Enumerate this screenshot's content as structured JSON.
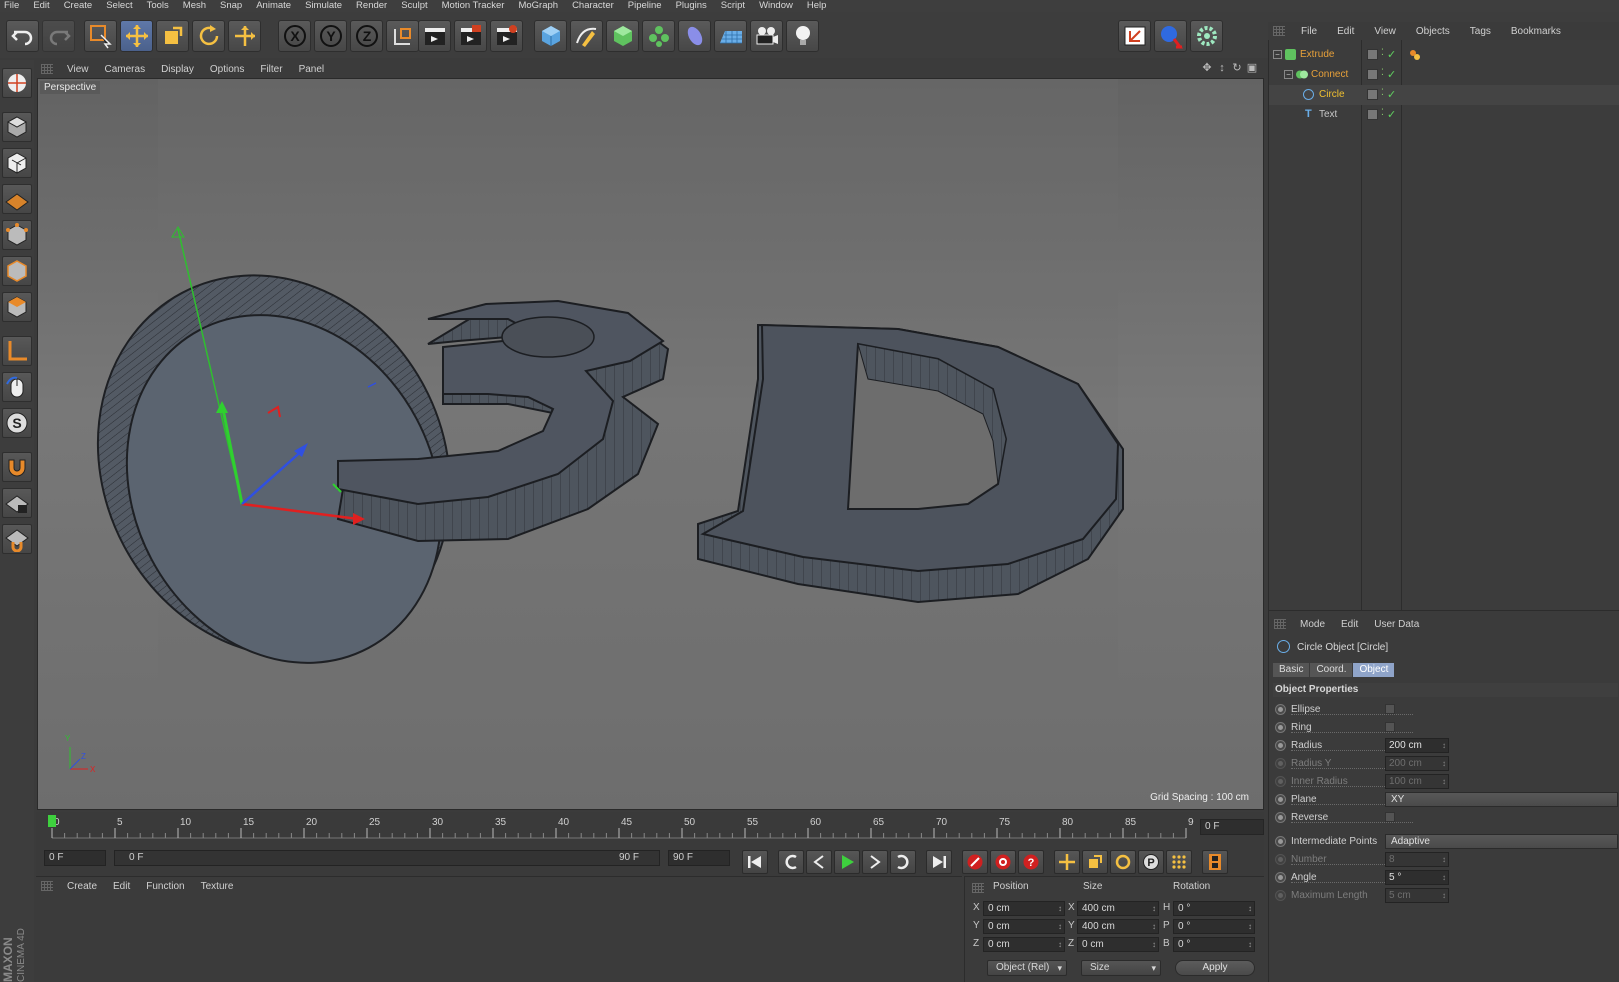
{
  "app": {
    "name": "MAXON CINEMA 4D",
    "brand_line1": "MAXON",
    "brand_line2": "CINEMA 4D"
  },
  "menubar": [
    "File",
    "Edit",
    "Create",
    "Select",
    "Tools",
    "Mesh",
    "Snap",
    "Animate",
    "Simulate",
    "Render",
    "Sculpt",
    "Motion Tracker",
    "MoGraph",
    "Character",
    "Pipeline",
    "Plugins",
    "Script",
    "Window",
    "Help"
  ],
  "toolbar": {
    "axis_labels": {
      "x": "X",
      "y": "Y",
      "z": "Z"
    }
  },
  "viewport": {
    "menu": [
      "View",
      "Cameras",
      "Display",
      "Options",
      "Filter",
      "Panel"
    ],
    "camera_label": "Perspective",
    "grid_spacing": "Grid Spacing : 100 cm",
    "scene_text": "3D",
    "axis_gizmo": {
      "x": "X",
      "y": "Y",
      "z": "Z"
    }
  },
  "timeline": {
    "ticks": [
      0,
      5,
      10,
      15,
      20,
      25,
      30,
      35,
      40,
      45,
      50,
      55,
      60,
      65,
      70,
      75,
      80,
      85,
      90
    ],
    "current_frame": "0 F"
  },
  "transport": {
    "start_field": "0 F",
    "range_start": "0 F",
    "range_end": "90 F",
    "end_field": "90 F"
  },
  "materials": {
    "menu": [
      "Create",
      "Edit",
      "Function",
      "Texture"
    ]
  },
  "coordinates": {
    "headers": {
      "position": "Position",
      "size": "Size",
      "rotation": "Rotation"
    },
    "axes": {
      "x": "X",
      "y": "Y",
      "z": "Z"
    },
    "rot_axes": {
      "h": "H",
      "p": "P",
      "b": "B"
    },
    "position": {
      "x": "0 cm",
      "y": "0 cm",
      "z": "0 cm"
    },
    "size": {
      "x": "400 cm",
      "y": "400 cm",
      "z": "0 cm"
    },
    "rotation": {
      "h": "0 °",
      "p": "0 °",
      "b": "0 °"
    },
    "mode_dropdown": "Object (Rel)",
    "size_dropdown": "Size",
    "apply_label": "Apply"
  },
  "object_manager": {
    "menu": [
      "File",
      "Edit",
      "View",
      "Objects",
      "Tags",
      "Bookmarks"
    ],
    "objects": [
      {
        "name": "Extrude",
        "color": "#e8a13a"
      },
      {
        "name": "Connect",
        "color": "#e8a13a"
      },
      {
        "name": "Circle",
        "color": "#f0c030"
      },
      {
        "name": "Text",
        "color": "#c8c8c8"
      }
    ]
  },
  "attributes": {
    "menu": [
      "Mode",
      "Edit",
      "User Data"
    ],
    "title": "Circle Object [Circle]",
    "tabs": [
      "Basic",
      "Coord.",
      "Object"
    ],
    "active_tab": "Object",
    "section": "Object Properties",
    "props": {
      "ellipse": "Ellipse",
      "ring": "Ring",
      "radius": "Radius",
      "radius_value": "200 cm",
      "radius_y": "Radius Y",
      "radius_y_value": "200 cm",
      "inner_radius": "Inner Radius",
      "inner_radius_value": "100 cm",
      "plane": "Plane",
      "plane_value": "XY",
      "reverse": "Reverse",
      "intermediate": "Intermediate Points",
      "intermediate_value": "Adaptive",
      "number": "Number",
      "number_value": "8",
      "angle": "Angle",
      "angle_value": "5 °",
      "max_length": "Maximum Length",
      "max_length_value": "5 cm"
    }
  },
  "colors": {
    "accent": "#5f78a8",
    "selected_tab": "#8fa4c9",
    "orange": "#e8a13a"
  }
}
